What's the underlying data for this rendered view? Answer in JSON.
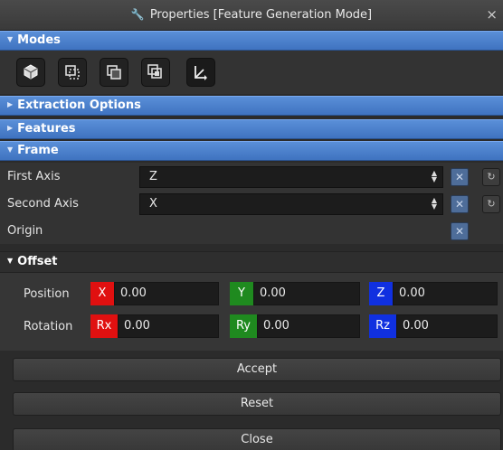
{
  "window": {
    "title": "Properties [Feature Generation Mode]",
    "close_glyph": "×"
  },
  "sections": {
    "modes": "Modes",
    "extraction": "Extraction Options",
    "features": "Features",
    "frame": "Frame"
  },
  "mode_buttons": [
    "object-mode-icon",
    "edge-feature-mode-icon",
    "face-feature-mode-icon",
    "multi-feature-mode-icon",
    "frame-axis-mode-icon"
  ],
  "frame": {
    "first_axis": {
      "label": "First Axis",
      "value": "Z"
    },
    "second_axis": {
      "label": "Second Axis",
      "value": "X"
    },
    "origin": {
      "label": "Origin"
    }
  },
  "offset": {
    "title": "Offset",
    "position": {
      "label": "Position",
      "x_tag": "X",
      "x": "0.00",
      "y_tag": "Y",
      "y": "0.00",
      "z_tag": "Z",
      "z": "0.00"
    },
    "rotation": {
      "label": "Rotation",
      "x_tag": "Rx",
      "x": "0.00",
      "y_tag": "Ry",
      "y": "0.00",
      "z_tag": "Rz",
      "z": "0.00"
    }
  },
  "colors": {
    "x_axis": "#e01010",
    "y_axis": "#1f8a1f",
    "z_axis": "#1030e0",
    "section": "#4a80cc"
  },
  "actions": {
    "accept": "Accept",
    "reset": "Reset",
    "close": "Close"
  }
}
